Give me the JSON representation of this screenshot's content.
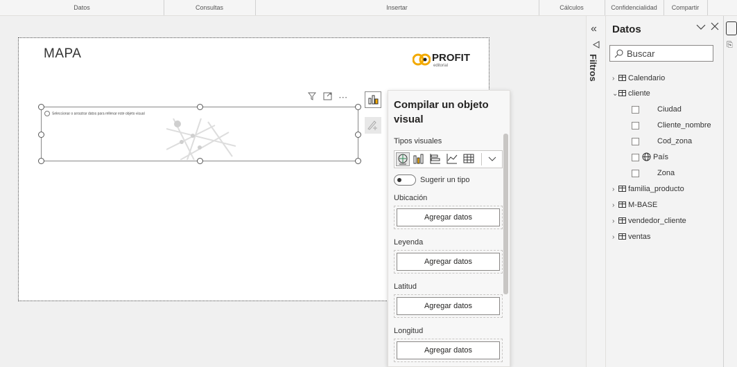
{
  "ribbon": {
    "groups": [
      "Datos",
      "Consultas",
      "Insertar",
      "Cálculos",
      "Confidencialidad",
      "Compartir"
    ]
  },
  "page": {
    "title": "MAPA",
    "logo": {
      "brand": "PROFIT",
      "sub": "editorial"
    }
  },
  "visual": {
    "hint": "Seleccionar o arrastrar datos para rellenar este objeto visual",
    "header_icons": [
      "filter-icon",
      "focus-mode-icon",
      "more-options-icon"
    ]
  },
  "compile_panel": {
    "title": "Compilar un objeto visual",
    "visual_types_label": "Tipos visuales",
    "visual_types": [
      "map",
      "clustered-column",
      "stacked-bar",
      "line-chart",
      "table"
    ],
    "selected_visual_type": "map",
    "suggest_label": "Sugerir un tipo",
    "wells": [
      {
        "label": "Ubicación",
        "button": "Agregar datos"
      },
      {
        "label": "Leyenda",
        "button": "Agregar datos"
      },
      {
        "label": "Latitud",
        "button": "Agregar datos"
      },
      {
        "label": "Longitud",
        "button": "Agregar datos"
      }
    ]
  },
  "filters_pane": {
    "label": "Filtros"
  },
  "data_pane": {
    "title": "Datos",
    "search_placeholder": "Buscar",
    "tables": [
      {
        "name": "Calendario",
        "expanded": false,
        "icon": "date-table-icon"
      },
      {
        "name": "cliente",
        "expanded": true,
        "icon": "table-icon",
        "fields": [
          {
            "name": "Ciudad",
            "icon": ""
          },
          {
            "name": "Cliente_nombre",
            "icon": ""
          },
          {
            "name": "Cod_zona",
            "icon": ""
          },
          {
            "name": "País",
            "icon": "globe-icon"
          },
          {
            "name": "Zona",
            "icon": ""
          }
        ]
      },
      {
        "name": "familia_producto",
        "expanded": false,
        "icon": "table-icon"
      },
      {
        "name": "M-BASE",
        "expanded": false,
        "icon": "date-table-icon"
      },
      {
        "name": "vendedor_cliente",
        "expanded": false,
        "icon": "table-icon"
      },
      {
        "name": "ventas",
        "expanded": false,
        "icon": "table-icon"
      }
    ]
  },
  "colors": {
    "accent_orange": "#f2a900",
    "border": "#8a8886"
  }
}
